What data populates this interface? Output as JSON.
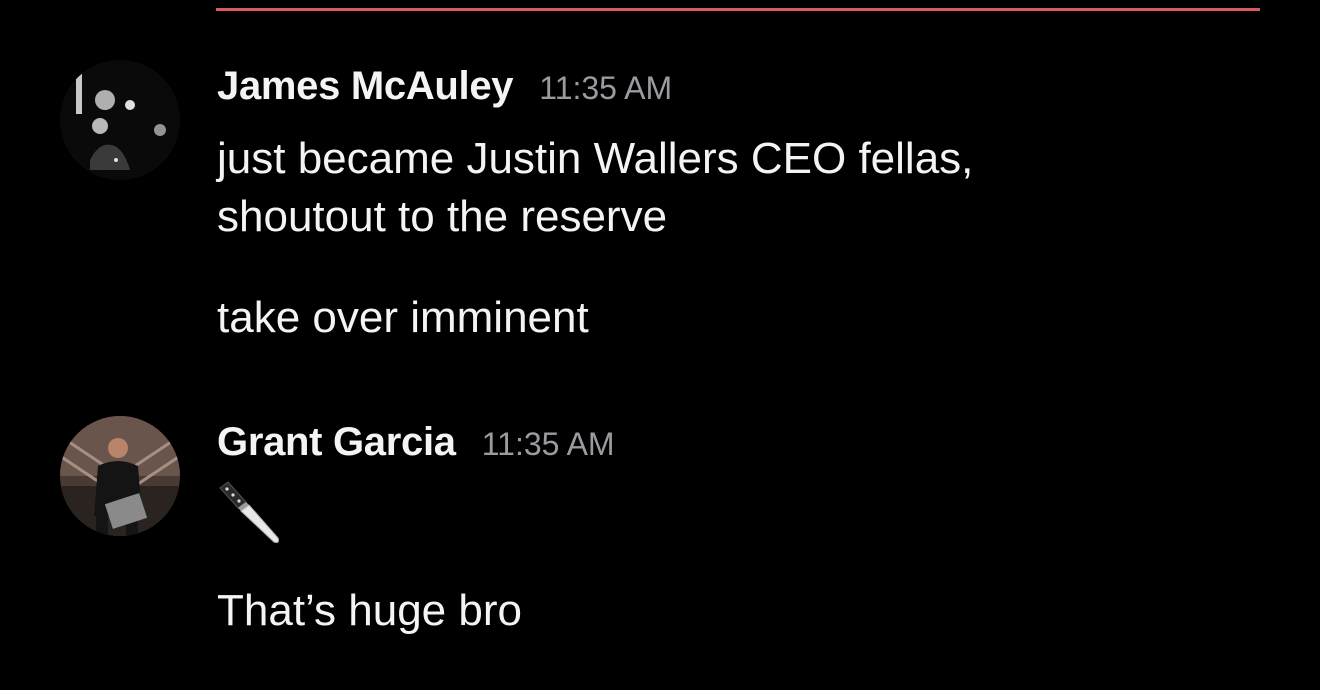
{
  "messages": [
    {
      "author": "James McAuley",
      "time": "11:35 AM",
      "avatar_icon": "user-avatar-photo",
      "lines": [
        "just became Justin Wallers CEO fellas,",
        "shoutout to the reserve"
      ],
      "text2": "take over imminent"
    },
    {
      "author": "Grant Garcia",
      "time": "11:35 AM",
      "avatar_icon": "user-avatar-photo",
      "emoji": "knife-icon",
      "text2": "That’s huge bro"
    }
  ],
  "colors": {
    "background": "#000000",
    "divider": "#d85a5e",
    "text": "#f4f4f4",
    "timestamp": "#9a9aa0"
  }
}
